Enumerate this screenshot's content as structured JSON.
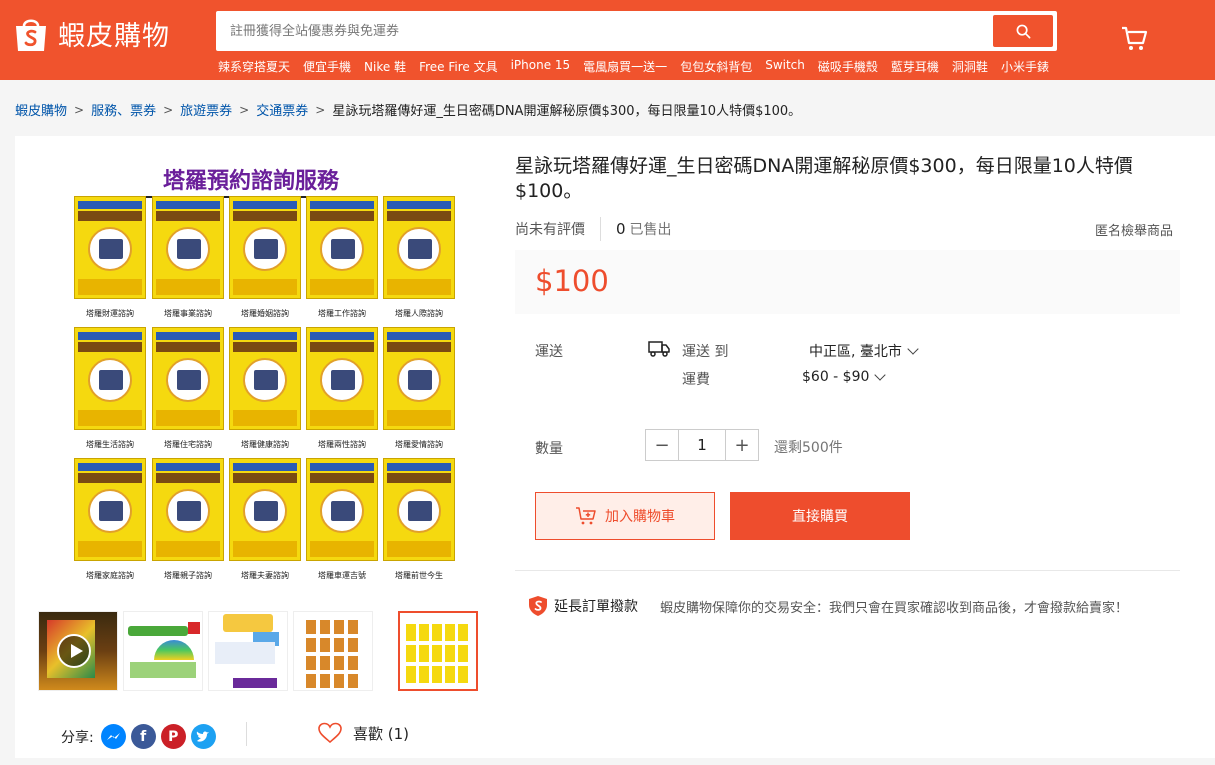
{
  "brand": {
    "name": "蝦皮購物",
    "color": "#f0532d",
    "accent": "#ee4d2d"
  },
  "search": {
    "placeholder": "註冊獲得全站優惠券與免運券",
    "icon": "search-icon"
  },
  "hot_words": [
    "辣系穿搭夏天",
    "便宜手機",
    "Nike 鞋",
    "Free Fire 文具",
    "iPhone 15",
    "電風扇買一送一",
    "包包女斜背包",
    "Switch",
    "磁吸手機殼",
    "藍芽耳機",
    "洞洞鞋",
    "小米手錶"
  ],
  "breadcrumb": {
    "items": [
      "蝦皮購物",
      "服務、票券",
      "旅遊票券",
      "交通票券"
    ],
    "current": "星詠玩塔羅傳好運_生日密碼DNA開運解秘原價$300，每日限量10人特價$100。"
  },
  "product": {
    "title": "星詠玩塔羅傳好運_生日密碼DNA開運解秘原價$300，每日限量10人特價$100。",
    "rating_text": "尚未有評價",
    "sold_count": "0",
    "sold_label": "已售出",
    "report_label": "匿名檢舉商品",
    "price": "$100",
    "image_title": "塔羅預約諮詢服務",
    "tile_labels": [
      "塔羅財運諮詢",
      "塔羅事業諮詢",
      "塔羅婚姻諮詢",
      "塔羅工作諮詢",
      "塔羅人際諮詢",
      "塔羅生活諮詢",
      "塔羅住宅諮詢",
      "塔羅健康諮詢",
      "塔羅兩性諮詢",
      "塔羅愛情諮詢",
      "塔羅家庭諮詢",
      "塔羅親子諮詢",
      "塔羅夫妻諮詢",
      "塔羅車運吉號",
      "塔羅前世今生"
    ]
  },
  "shipping": {
    "label": "運送",
    "to_label": "運送 到",
    "location": "中正區, 臺北市",
    "fee_label": "運費",
    "fee": "$60 - $90"
  },
  "quantity": {
    "label": "數量",
    "value": "1",
    "minus": "−",
    "plus": "+",
    "stock": "還剩500件"
  },
  "buttons": {
    "add_to_cart": "加入購物車",
    "buy_now": "直接購買"
  },
  "guarantee": {
    "title": "延長訂單撥款",
    "desc": "蝦皮購物保障你的交易安全：我們只會在買家確認收到商品後，才會撥款給賣家！"
  },
  "share": {
    "label": "分享:",
    "icons": [
      "messenger-icon",
      "facebook-icon",
      "pinterest-icon",
      "twitter-icon"
    ]
  },
  "favorite": {
    "label": "喜歡 (1)"
  }
}
